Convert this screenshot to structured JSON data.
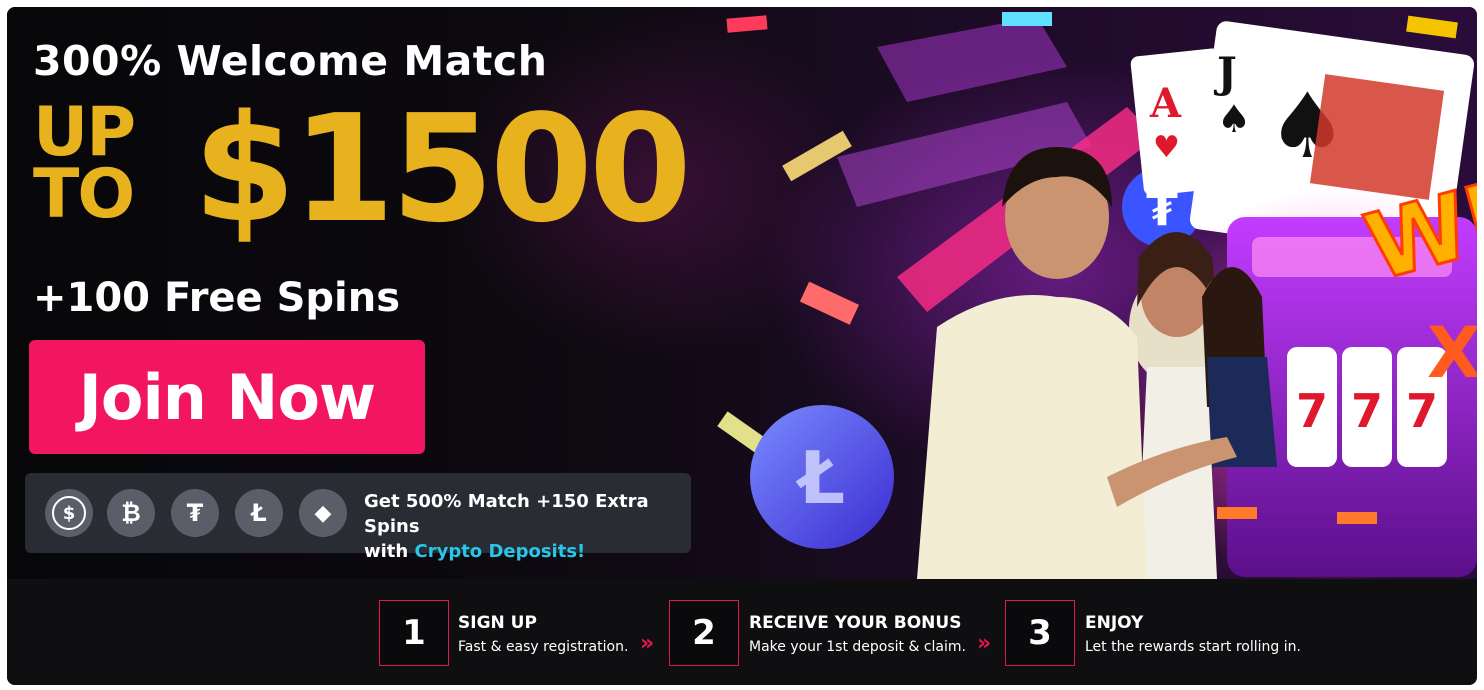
{
  "hero": {
    "headline": "300% Welcome Match",
    "up_to_line1": "UP",
    "up_to_line2": "TO",
    "amount": "$1500",
    "free_spins": "+100 Free Spins",
    "cta_label": "Join Now"
  },
  "crypto_banner": {
    "coins": [
      {
        "icon": "usdc-icon",
        "glyph": "$"
      },
      {
        "icon": "bitcoin-icon",
        "glyph": "₿"
      },
      {
        "icon": "tether-icon",
        "glyph": "₮"
      },
      {
        "icon": "litecoin-icon",
        "glyph": "Ł"
      },
      {
        "icon": "ethereum-icon",
        "glyph": "◆"
      }
    ],
    "line1": "Get 500% Match +150 Extra Spins",
    "line2_prefix": "with",
    "line2_highlight": "Crypto Deposits!"
  },
  "steps": [
    {
      "number": "1",
      "title": "SIGN UP",
      "subtitle": "Fast & easy registration."
    },
    {
      "number": "2",
      "title": "RECEIVE YOUR BONUS",
      "subtitle": "Make your 1st deposit & claim."
    },
    {
      "number": "3",
      "title": "ENJOY",
      "subtitle": "Let the rewards start rolling in."
    }
  ],
  "step_separator": "»",
  "artwork": {
    "card_ace": "A",
    "card_jack": "J",
    "suit_hearts": "♥",
    "suit_spades": "♠",
    "slot_reels": [
      "7",
      "7",
      "7"
    ],
    "neon_sign": "WI",
    "neon_x": "X"
  },
  "colors": {
    "accent_pink": "#f2155f",
    "gold": "#e8b21e",
    "crypto_highlight": "#27c7ea",
    "step_border": "#e3174f"
  }
}
